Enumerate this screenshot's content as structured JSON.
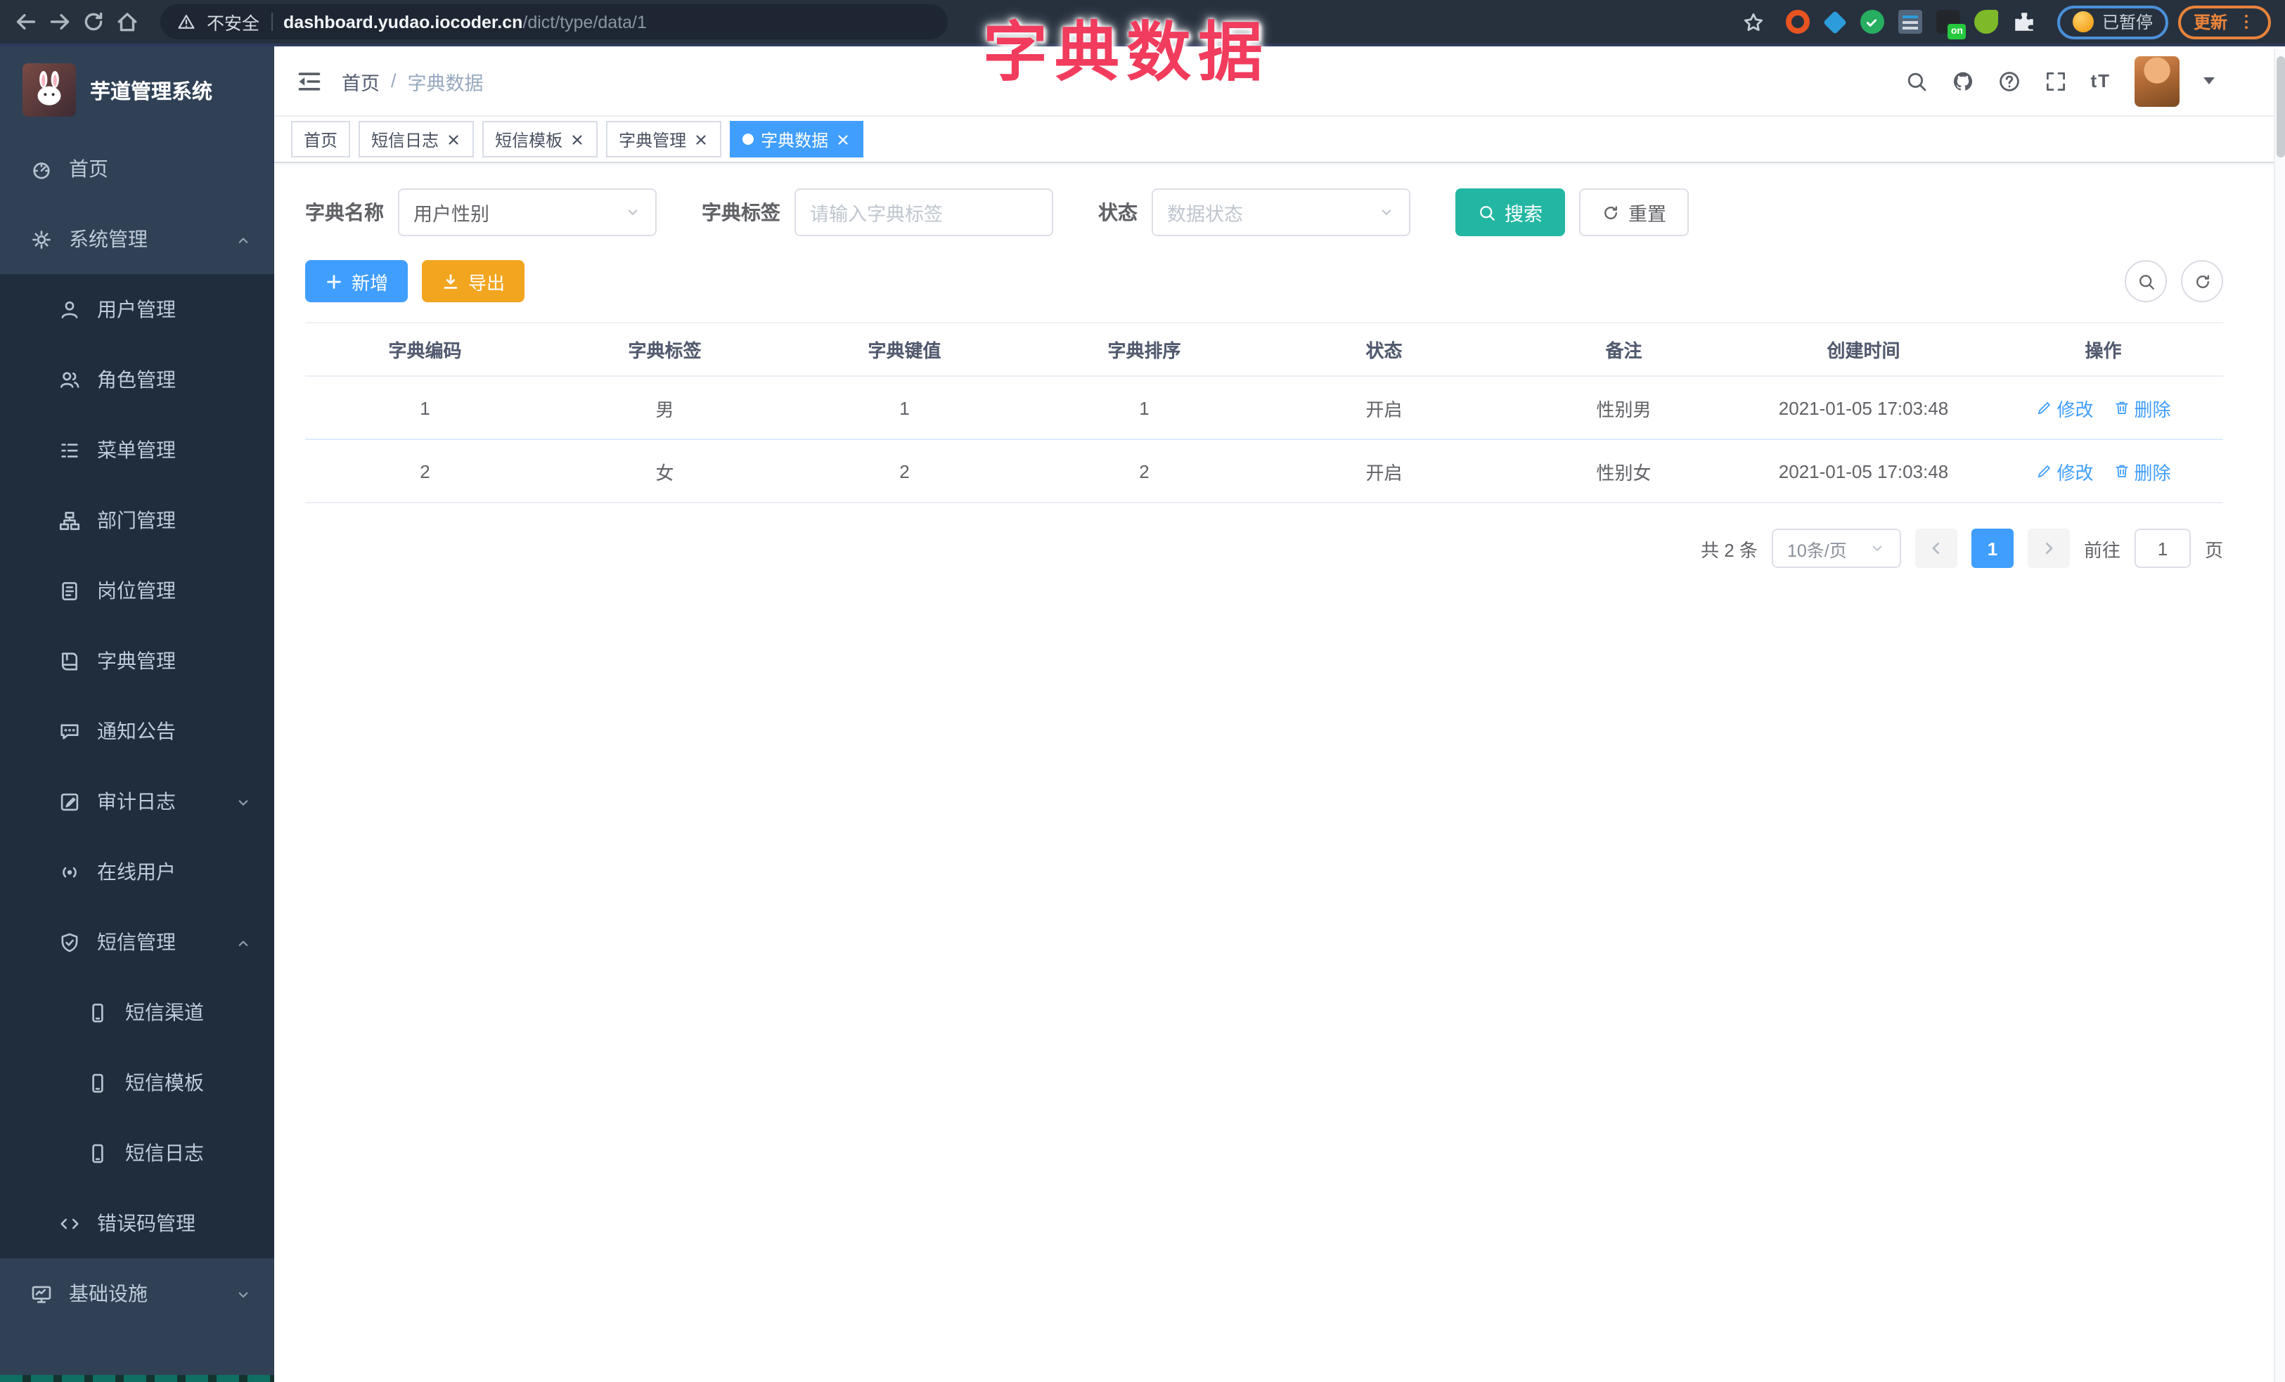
{
  "colors": {
    "accent": "#409EFF",
    "teal": "#23B7A3",
    "warning": "#F2A51F",
    "overlay": "#F13C5D"
  },
  "overlay_title": "字典数据",
  "browser": {
    "security": "不安全",
    "host": "dashboard.yudao.iocoder.cn",
    "path": "/dict/type/data/1",
    "ext_on": "on",
    "paused": "已暂停",
    "update": "更新"
  },
  "sidebar": {
    "app_title": "芋道管理系统",
    "items": [
      {
        "label": "首页",
        "icon": "dashboard",
        "level": 1
      },
      {
        "label": "系统管理",
        "icon": "gear",
        "level": 1,
        "chevron": "up"
      },
      {
        "label": "用户管理",
        "icon": "user",
        "level": 2
      },
      {
        "label": "角色管理",
        "icon": "users",
        "level": 2
      },
      {
        "label": "菜单管理",
        "icon": "menu-list",
        "level": 2
      },
      {
        "label": "部门管理",
        "icon": "org-tree",
        "level": 2
      },
      {
        "label": "岗位管理",
        "icon": "badge",
        "level": 2
      },
      {
        "label": "字典管理",
        "icon": "book",
        "level": 2
      },
      {
        "label": "通知公告",
        "icon": "chat-bubble",
        "level": 2
      },
      {
        "label": "审计日志",
        "icon": "audit-log",
        "level": 2,
        "chevron": "down"
      },
      {
        "label": "在线用户",
        "icon": "online",
        "level": 2
      },
      {
        "label": "短信管理",
        "icon": "shield-check",
        "level": 2,
        "chevron": "up"
      },
      {
        "label": "短信渠道",
        "icon": "phone",
        "level": 3
      },
      {
        "label": "短信模板",
        "icon": "phone",
        "level": 3
      },
      {
        "label": "短信日志",
        "icon": "phone",
        "level": 3
      },
      {
        "label": "错误码管理",
        "icon": "code",
        "level": 2
      },
      {
        "label": "基础设施",
        "icon": "monitor",
        "level": 1,
        "chevron": "down"
      }
    ]
  },
  "header": {
    "breadcrumb_home": "首页",
    "breadcrumb_sep": "/",
    "breadcrumb_current": "字典数据",
    "font_size_label": "tT"
  },
  "tabs": [
    {
      "label": "首页",
      "closable": false,
      "active": false
    },
    {
      "label": "短信日志",
      "closable": true,
      "active": false
    },
    {
      "label": "短信模板",
      "closable": true,
      "active": false
    },
    {
      "label": "字典管理",
      "closable": true,
      "active": false
    },
    {
      "label": "字典数据",
      "closable": true,
      "active": true
    }
  ],
  "filters": {
    "dict_name_label": "字典名称",
    "dict_name_value": "用户性别",
    "dict_label_label": "字典标签",
    "dict_label_placeholder": "请输入字典标签",
    "status_label": "状态",
    "status_placeholder": "数据状态",
    "search_label": "搜索",
    "reset_label": "重置"
  },
  "actions": {
    "add_label": "新增",
    "export_label": "导出"
  },
  "table": {
    "headers": [
      "字典编码",
      "字典标签",
      "字典键值",
      "字典排序",
      "状态",
      "备注",
      "创建时间",
      "操作"
    ],
    "rows": [
      {
        "code": "1",
        "label": "男",
        "value": "1",
        "sort": "1",
        "status": "开启",
        "remark": "性别男",
        "created_at": "2021-01-05 17:03:48"
      },
      {
        "code": "2",
        "label": "女",
        "value": "2",
        "sort": "2",
        "status": "开启",
        "remark": "性别女",
        "created_at": "2021-01-05 17:03:48"
      }
    ],
    "row_actions": {
      "edit": "修改",
      "delete": "删除"
    }
  },
  "pagination": {
    "total": "共 2 条",
    "page_size": "10条/页",
    "current_page": "1",
    "goto_label": "前往",
    "goto_value": "1",
    "unit_label": "页"
  }
}
